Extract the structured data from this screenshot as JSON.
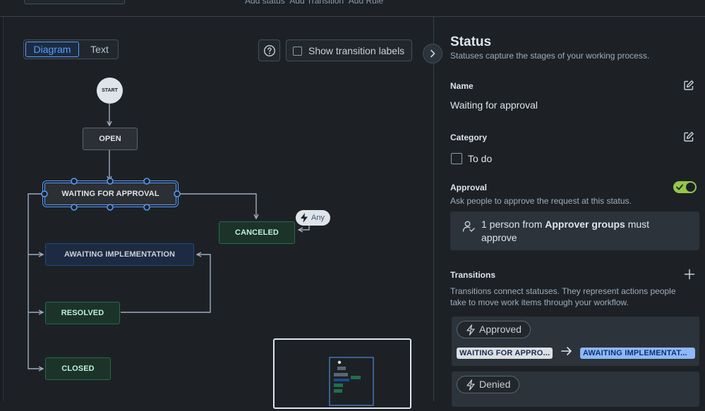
{
  "topbar": {
    "links": [
      "Add status",
      "Add Transition",
      "Add Rule"
    ]
  },
  "canvas": {
    "view_toggle": {
      "diagram": "Diagram",
      "text": "Text",
      "selected": "Diagram"
    },
    "help_icon": "question-circle-icon",
    "show_transition_labels": {
      "label": "Show transition labels",
      "checked": false
    },
    "start_label": "START",
    "any_label": "Any",
    "nodes": {
      "open": "OPEN",
      "waiting": "WAITING FOR APPROVAL",
      "awaiting": "AWAITING IMPLEMENTATION",
      "resolved": "RESOLVED",
      "closed": "CLOSED",
      "canceled": "CANCELED"
    },
    "colors": {
      "todo": "#2c2f33",
      "in_progress": "#1c2b41",
      "done": "#1c3329",
      "selected": "#579dff"
    }
  },
  "panel": {
    "title": "Status",
    "subtitle": "Statuses capture the stages of your working process.",
    "name_label": "Name",
    "name_value": "Waiting for approval",
    "category_label": "Category",
    "category_value": "To do",
    "approval_label": "Approval",
    "approval_enabled": true,
    "approval_desc": "Ask people to approve the request at this status.",
    "approval_rule": {
      "prefix": "1 person from ",
      "group": "Approver groups",
      "suffix": " must approve"
    },
    "transitions_label": "Transitions",
    "transitions_desc": "Transitions connect statuses. They represent actions people take to move work items through your workflow.",
    "transitions": [
      {
        "name": "Approved",
        "from": "WAITING FOR APPRO...",
        "to": "AWAITING IMPLEMENTAT..."
      },
      {
        "name": "Denied"
      }
    ]
  }
}
